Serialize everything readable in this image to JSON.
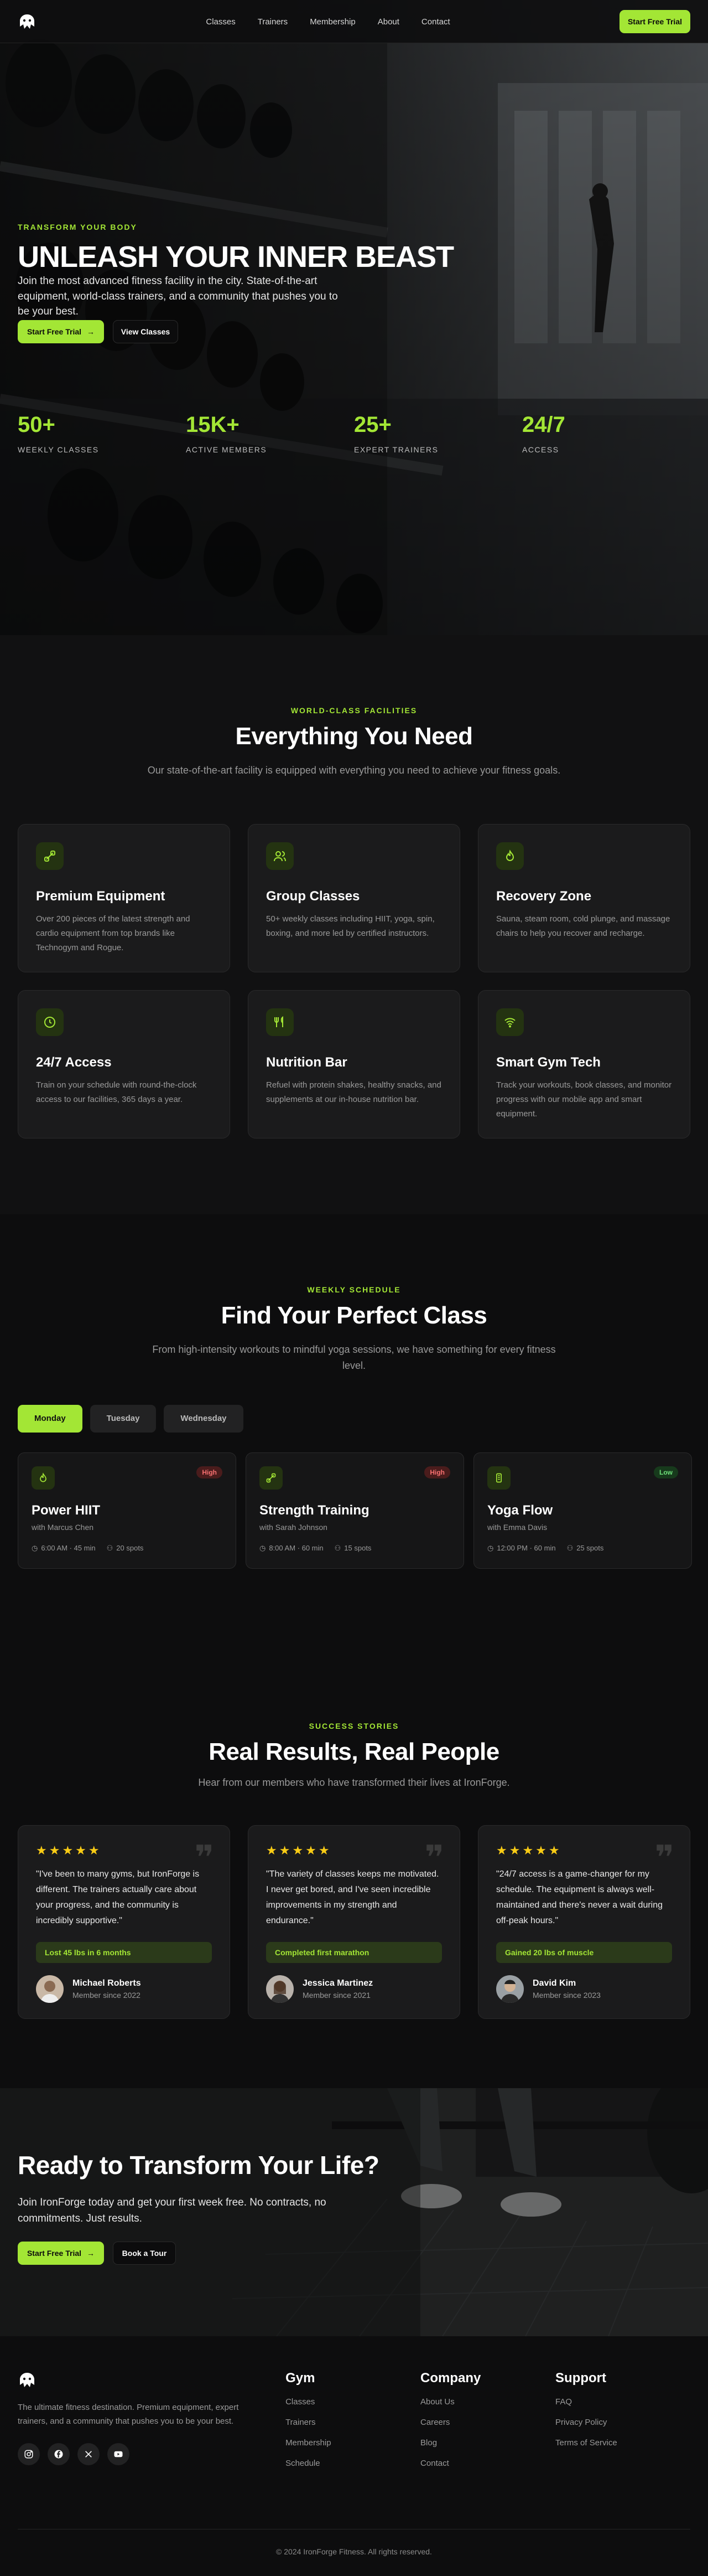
{
  "nav": {
    "links": [
      "Classes",
      "Trainers",
      "Membership",
      "About",
      "Contact"
    ],
    "cta": "Start Free Trial"
  },
  "hero": {
    "eyebrow": "TRANSFORM YOUR BODY",
    "title": "UNLEASH YOUR INNER BEAST",
    "text": "Join the most advanced fitness facility in the city. State-of-the-art equipment, world-class trainers, and a community that pushes you to be your best.",
    "primary": "Start Free Trial",
    "secondary": "View Classes",
    "stats": [
      {
        "value": "50+",
        "label": "WEEKLY CLASSES"
      },
      {
        "value": "15K+",
        "label": "ACTIVE MEMBERS"
      },
      {
        "value": "25+",
        "label": "EXPERT TRAINERS"
      },
      {
        "value": "24/7",
        "label": "ACCESS"
      }
    ]
  },
  "facilities": {
    "eyebrow": "WORLD-CLASS FACILITIES",
    "title": "Everything You Need",
    "text": "Our state-of-the-art facility is equipped with everything you need to achieve your fitness goals.",
    "items": [
      {
        "icon": "dumbbell-icon",
        "title": "Premium Equipment",
        "text": "Over 200 pieces of the latest strength and cardio equipment from top brands like Technogym and Rogue."
      },
      {
        "icon": "users-icon",
        "title": "Group Classes",
        "text": "50+ weekly classes including HIIT, yoga, spin, boxing, and more led by certified instructors."
      },
      {
        "icon": "flame-icon",
        "title": "Recovery Zone",
        "text": "Sauna, steam room, cold plunge, and massage chairs to help you recover and recharge."
      },
      {
        "icon": "clock-icon",
        "title": "24/7 Access",
        "text": "Train on your schedule with round-the-clock access to our facilities, 365 days a year."
      },
      {
        "icon": "utensils-icon",
        "title": "Nutrition Bar",
        "text": "Refuel with protein shakes, healthy snacks, and supplements at our in-house nutrition bar."
      },
      {
        "icon": "wifi-icon",
        "title": "Smart Gym Tech",
        "text": "Track your workouts, book classes, and monitor progress with our mobile app and smart equipment."
      }
    ]
  },
  "schedule": {
    "eyebrow": "WEEKLY SCHEDULE",
    "title": "Find Your Perfect Class",
    "text": "From high-intensity workouts to mindful yoga sessions, we have something for every fitness level.",
    "tabs": [
      "Monday",
      "Tuesday",
      "Wednesday"
    ],
    "classes": [
      {
        "icon": "flame-icon",
        "badge": "High",
        "title": "Power HIIT",
        "instructor": "with Marcus Chen",
        "time": "6:00 AM · 45 min",
        "spots": "20 spots"
      },
      {
        "icon": "dumbbell-icon",
        "badge": "High",
        "title": "Strength Training",
        "instructor": "with Sarah Johnson",
        "time": "8:00 AM · 60 min",
        "spots": "15 spots"
      },
      {
        "icon": "phone-icon",
        "badge": "Low",
        "title": "Yoga Flow",
        "instructor": "with Emma Davis",
        "time": "12:00 PM · 60 min",
        "spots": "25 spots"
      }
    ]
  },
  "results": {
    "eyebrow": "SUCCESS STORIES",
    "title": "Real Results, Real People",
    "text": "Hear from our members who have transformed their lives at IronForge.",
    "items": [
      {
        "stars": "★★★★★",
        "quote": "\"I've been to many gyms, but IronForge is different. The trainers actually care about your progress, and the community is incredibly supportive.\"",
        "result": "Lost 45 lbs in 6 months",
        "name": "Michael Roberts",
        "since": "Member since 2022"
      },
      {
        "stars": "★★★★★",
        "quote": "\"The variety of classes keeps me motivated. I never get bored, and I've seen incredible improvements in my strength and endurance.\"",
        "result": "Completed first marathon",
        "name": "Jessica Martinez",
        "since": "Member since 2021"
      },
      {
        "stars": "★★★★★",
        "quote": "\"24/7 access is a game-changer for my schedule. The equipment is always well-maintained and there's never a wait during off-peak hours.\"",
        "result": "Gained 20 lbs of muscle",
        "name": "David Kim",
        "since": "Member since 2023"
      }
    ]
  },
  "cta": {
    "title": "Ready to Transform Your Life?",
    "text": "Join IronForge today and get your first week free. No contracts, no commitments. Just results.",
    "primary": "Start Free Trial",
    "secondary": "Book a Tour"
  },
  "footer": {
    "text": "The ultimate fitness destination. Premium equipment, expert trainers, and a community that pushes you to be your best.",
    "cols": [
      {
        "title": "Gym",
        "links": [
          "Classes",
          "Trainers",
          "Membership",
          "Schedule"
        ]
      },
      {
        "title": "Company",
        "links": [
          "About Us",
          "Careers",
          "Blog",
          "Contact"
        ]
      },
      {
        "title": "Support",
        "links": [
          "FAQ",
          "Privacy Policy",
          "Terms of Service"
        ]
      }
    ],
    "copyright": "© 2024 IronForge Fitness. All rights reserved."
  },
  "colors": {
    "accent": "#a3e635",
    "bg": "#111112",
    "card": "#1b1b1c"
  }
}
